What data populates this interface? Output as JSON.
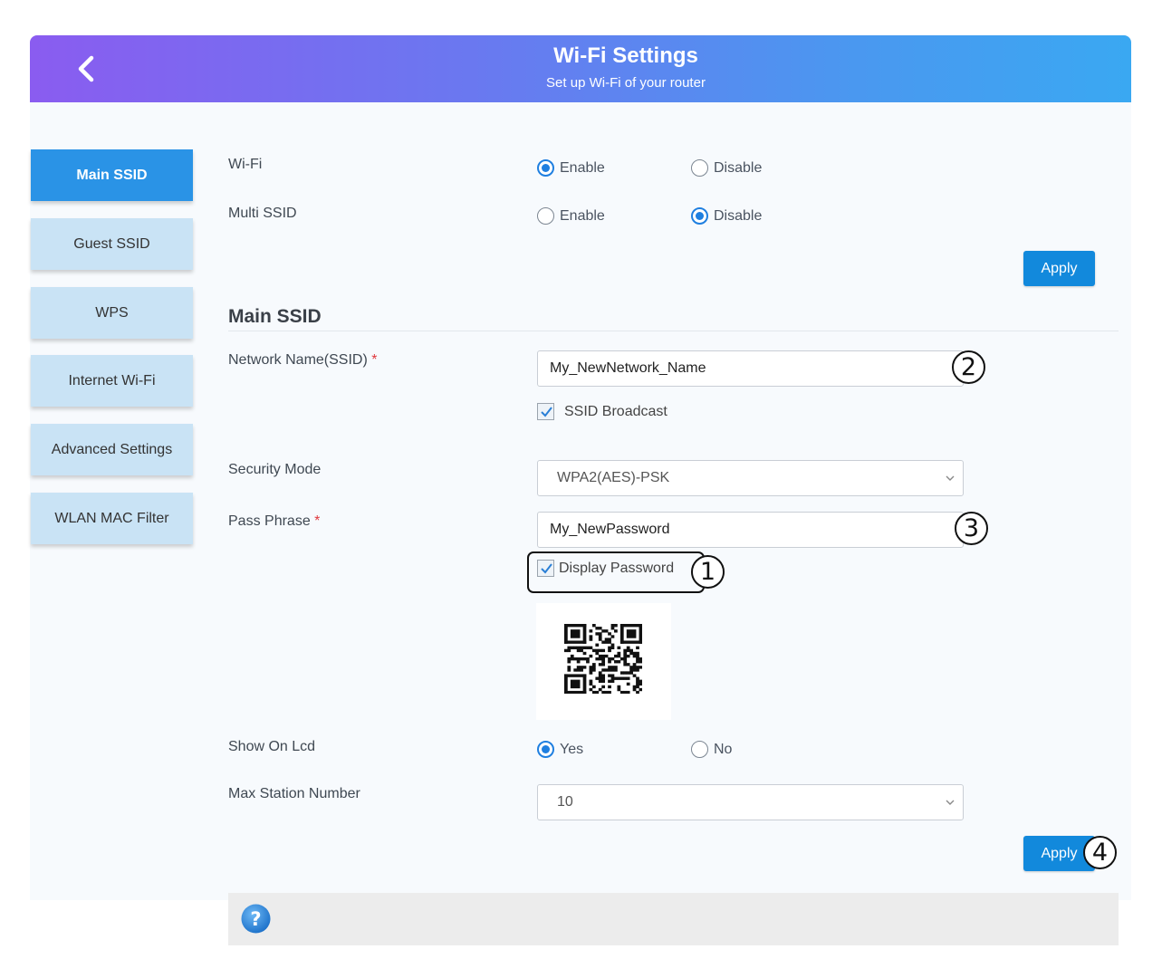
{
  "header": {
    "title": "Wi-Fi Settings",
    "subtitle": "Set up Wi-Fi of your router",
    "back_icon": "chevron-left-icon"
  },
  "sidebar": {
    "items": [
      {
        "label": "Main SSID",
        "active": true
      },
      {
        "label": "Guest SSID",
        "active": false
      },
      {
        "label": "WPS",
        "active": false
      },
      {
        "label": "Internet Wi-Fi",
        "active": false
      },
      {
        "label": "Advanced Settings",
        "active": false
      },
      {
        "label": "WLAN MAC Filter",
        "active": false
      }
    ]
  },
  "wifi": {
    "label": "Wi-Fi",
    "enable": "Enable",
    "disable": "Disable",
    "selected": "Enable"
  },
  "multi_ssid": {
    "label": "Multi SSID",
    "enable": "Enable",
    "disable": "Disable",
    "selected": "Disable"
  },
  "apply_top": "Apply",
  "main": {
    "section_title": "Main SSID",
    "network_name_label": "Network Name(SSID)",
    "network_name_value": "My_NewNetwork_Name",
    "required_mark": "*",
    "ssid_broadcast": {
      "label": "SSID Broadcast",
      "checked": true
    },
    "security_mode_label": "Security Mode",
    "security_mode_value": "WPA2(AES)-PSK",
    "pass_phrase_label": "Pass Phrase",
    "pass_phrase_value": "My_NewPassword",
    "display_password": {
      "label": "Display Password",
      "checked": true
    },
    "show_on_lcd": {
      "label": "Show On Lcd",
      "yes": "Yes",
      "no": "No",
      "selected": "Yes"
    },
    "max_station_label": "Max Station Number",
    "max_station_value": "10",
    "apply_label": "Apply"
  },
  "annotations": [
    "1",
    "2",
    "3",
    "4"
  ],
  "colors": {
    "accent": "#1289dc",
    "sidebar_active": "#2a93e6",
    "sidebar_item": "#c9e3f5",
    "radio_on": "#1f7fe0",
    "required": "#e0393e"
  },
  "help_icon": "question-circle-icon"
}
